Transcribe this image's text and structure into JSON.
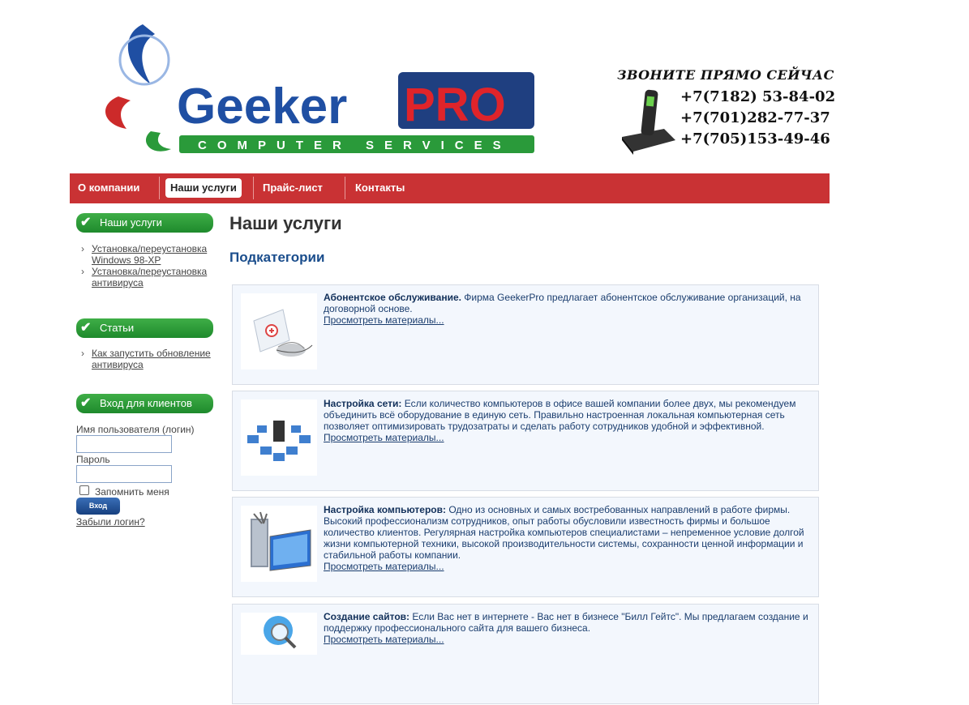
{
  "logo": {
    "word": "Geeker",
    "pro": "PRO",
    "tagline": "COMPUTER SERVICES"
  },
  "contact": {
    "call": "ЗВОНИТЕ ПРЯМО СЕЙЧАС",
    "phones": [
      "+7(7182) 53-84-02",
      "+7(701)282-77-37",
      "+7(705)153-49-46"
    ]
  },
  "nav": {
    "items": [
      "О компании",
      "Наши услуги",
      "Прайс-лист",
      "Контакты"
    ],
    "active": "Наши услуги"
  },
  "sidebar": {
    "services": {
      "title": "Наши услуги",
      "links": [
        "Установка/переустановка Windows 98-XP",
        "Установка/переустановка антивируса"
      ]
    },
    "articles": {
      "title": "Статьи",
      "links": [
        "Как запустить обновление антивируса"
      ]
    },
    "login": {
      "title": "Вход для клиентов",
      "username_label": "Имя пользователя (логин)",
      "password_label": "Пароль",
      "remember_label": "Запомнить меня",
      "submit": "Вход",
      "forgot": "Забыли логин?"
    }
  },
  "main": {
    "title": "Наши услуги",
    "subtitle": "Подкатегории",
    "more_label": "Просмотреть материалы...",
    "cards": [
      {
        "title": "Абонентское обслуживание.",
        "text": "Фирма GeekerPro предлагает абонентское обслуживание организаций, на договорной основе."
      },
      {
        "title": "Настройка сети:",
        "text": "Если количество компьютеров в офисе вашей компании более двух, мы рекомендуем объединить всё оборудование в единую сеть. Правильно настроенная локальная компьютерная сеть позволяет оптимизировать трудозатраты и сделать работу сотрудников удобной и эффективной."
      },
      {
        "title": "Настройка компьютеров:",
        "text": "Одно из основных и самых востребованных направлений в работе фирмы. Высокий профессионализм сотрудников, опыт работы обусловили известность фирмы и большое количество клиентов. Регулярная настройка компьютеров специалистами – непременное условие долгой жизни компьютерной техники, высокой производительности системы, сохранности ценной информации и стабильной работы компании."
      },
      {
        "title": "Создание сайтов:",
        "text": "Если Вас нет в интернете - Вас нет в бизнесе \"Билл Гейтс\". Мы предлагаем создание и поддержку профессионального сайта для вашего бизнеса."
      }
    ]
  },
  "colors": {
    "nav": "#c93234",
    "green": "#2a9a3a",
    "blue": "#1a4d8c"
  }
}
